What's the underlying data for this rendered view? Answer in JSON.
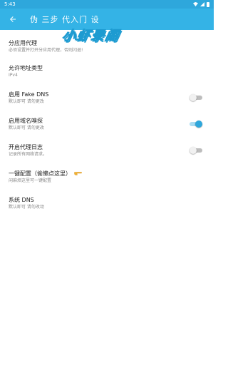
{
  "status_bar": {
    "time": "5:43"
  },
  "app_bar": {
    "title": "伪 三步 代入门 设",
    "watermark": "小虾录阁"
  },
  "colors": {
    "primary": "#34b3e6",
    "status_bar": "#2ea7dc",
    "toggle_on": "#2ea7dc",
    "toggle_off": "#bdbdbd"
  },
  "settings": [
    {
      "title": "分应用代理",
      "summary": "必须设置并打开分应用代理，否则闪退!"
    },
    {
      "title": "允许地址类型",
      "summary": "IPv4"
    },
    {
      "title": "启用 Fake DNS",
      "summary": "默认即可 请勿更改",
      "toggle": false
    },
    {
      "title": "启用域名嗅探",
      "summary": "默认即可 请勿更改",
      "toggle": true
    },
    {
      "title": "开启代理日志",
      "summary": "记录所有网络请求。",
      "toggle": false
    },
    {
      "title": "一键配置（偷懒点这里）",
      "summary": "闲麻烦这里可一键配置",
      "icon": "pointing-hand-icon"
    },
    {
      "title": "系统 DNS",
      "summary": "默认即可 请勿改动"
    }
  ]
}
